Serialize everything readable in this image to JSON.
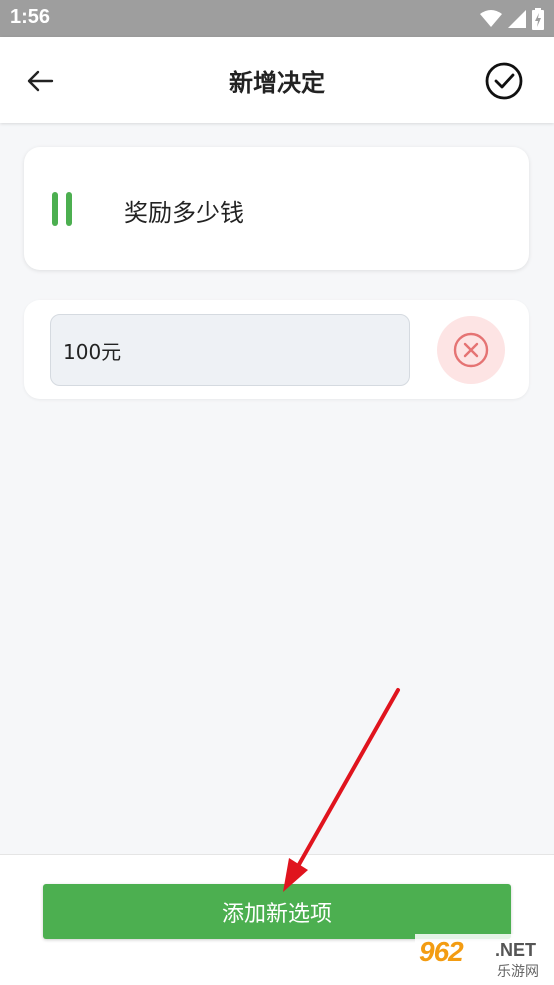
{
  "status_bar": {
    "time": "1:56",
    "icons": [
      "wifi-icon",
      "signal-icon",
      "battery-icon"
    ],
    "background": "#9e9e9e"
  },
  "app_bar": {
    "title": "新增决定",
    "back_icon": "arrow-left-icon",
    "confirm_icon": "check-circle-icon"
  },
  "question": {
    "text": "奖励多少钱",
    "handle_icon": "drag-handle-icon",
    "accent": "#4caf50"
  },
  "options": [
    {
      "value": "100元",
      "remove_icon": "close-circle-icon"
    }
  ],
  "bottom": {
    "add_option_label": "添加新选项",
    "button_color": "#4caf50"
  },
  "watermark": {
    "logo": "962",
    "net": ".NET",
    "cn": "乐游网"
  }
}
